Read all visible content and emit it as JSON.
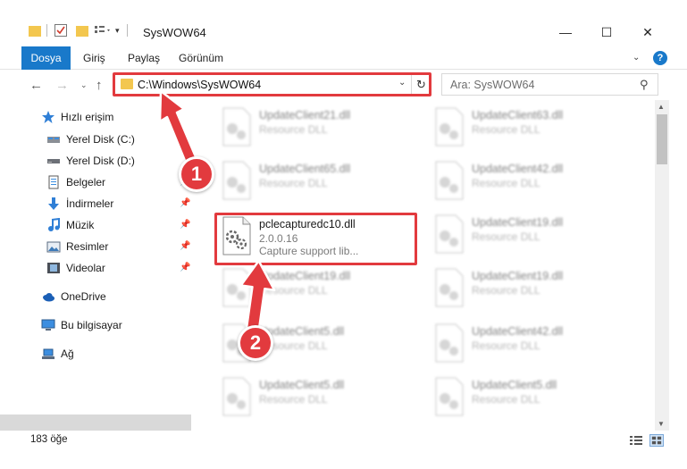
{
  "window": {
    "title": "SysWOW64",
    "minimize": "—",
    "maximize": "☐",
    "close": "✕"
  },
  "ribbon": {
    "tabs": [
      "Dosya",
      "Giriş",
      "Paylaş",
      "Görünüm"
    ],
    "help": "?"
  },
  "address": {
    "path": "C:\\Windows\\SysWOW64",
    "search_placeholder": "Ara: SysWOW64"
  },
  "sidebar": {
    "quick_access": "Hızlı erişim",
    "items": [
      {
        "label": "Yerel Disk (C:)",
        "icon": "drive-icon",
        "pinned": false
      },
      {
        "label": "Yerel Disk (D:)",
        "icon": "drive-icon",
        "pinned": false
      },
      {
        "label": "Belgeler",
        "icon": "documents-icon",
        "pinned": true
      },
      {
        "label": "İndirmeler",
        "icon": "downloads-icon",
        "pinned": true
      },
      {
        "label": "Müzik",
        "icon": "music-icon",
        "pinned": true
      },
      {
        "label": "Resimler",
        "icon": "pictures-icon",
        "pinned": true
      },
      {
        "label": "Videolar",
        "icon": "videos-icon",
        "pinned": true
      }
    ],
    "onedrive": "OneDrive",
    "this_pc": "Bu bilgisayar",
    "network": "Ağ"
  },
  "files": {
    "left": [
      {
        "name": "UpdateClient21.dll",
        "desc": "Resource DLL"
      },
      {
        "name": "UpdateClient65.dll",
        "desc": "Resource DLL"
      },
      {
        "name": "pclecapturedc10.dll",
        "version": "2.0.0.16",
        "desc": "Capture support lib..."
      },
      {
        "name": "UpdateClient19.dll",
        "desc": "Resource DLL"
      },
      {
        "name": "UpdateClient5.dll",
        "desc": "Resource DLL"
      },
      {
        "name": "UpdateClient5.dll",
        "desc": "Resource DLL"
      }
    ],
    "right": [
      {
        "name": "UpdateClient63.dll",
        "desc": "Resource DLL"
      },
      {
        "name": "UpdateClient42.dll",
        "desc": "Resource DLL"
      },
      {
        "name": "UpdateClient19.dll",
        "desc": "Resource DLL"
      },
      {
        "name": "UpdateClient19.dll",
        "desc": "Resource DLL"
      },
      {
        "name": "UpdateClient42.dll",
        "desc": "Resource DLL"
      },
      {
        "name": "UpdateClient5.dll",
        "desc": "Resource DLL"
      }
    ]
  },
  "annotations": {
    "step1": "1",
    "step2": "2"
  },
  "status": {
    "count": "183 öğe"
  },
  "colors": {
    "accent": "#1979ca",
    "highlight": "#e23a3e",
    "folder": "#f3c74f"
  }
}
